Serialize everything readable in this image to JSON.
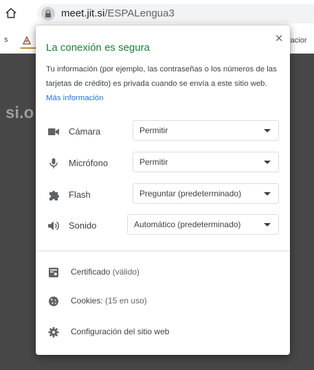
{
  "browser": {
    "url_host": "meet.jit.si",
    "url_path": "/ESPALengua3",
    "bookmark_left_text": "s",
    "bookmark_right_text": "racior"
  },
  "page": {
    "background_text": "si.o"
  },
  "popup": {
    "close_symbol": "×",
    "title": "La conexión es segura",
    "description": "Tu información (por ejemplo, las contraseñas o los números de las tarjetas de crédito) es privada cuando se envía a este sitio web.",
    "more_link": "Más información",
    "permissions": [
      {
        "icon": "camera-icon",
        "label": "Cámara",
        "value": "Permitir"
      },
      {
        "icon": "microphone-icon",
        "label": "Micrófono",
        "value": "Permitir"
      },
      {
        "icon": "puzzle-icon",
        "label": "Flash",
        "value": "Preguntar (predeterminado)"
      },
      {
        "icon": "speaker-icon",
        "label": "Sonido",
        "value": "Automático (predeterminado)"
      }
    ],
    "certificate": {
      "label": "Certificado",
      "detail": "(válido)",
      "icon": "certificate-icon"
    },
    "cookies": {
      "label": "Cookies:",
      "detail": "(15 en uso)",
      "icon": "cookie-icon"
    },
    "site_settings": {
      "label": "Configuración del sitio web",
      "icon": "gear-icon"
    }
  },
  "colors": {
    "secure_green": "#188038",
    "link_blue": "#1a73e8",
    "page_dark": "#474747"
  }
}
